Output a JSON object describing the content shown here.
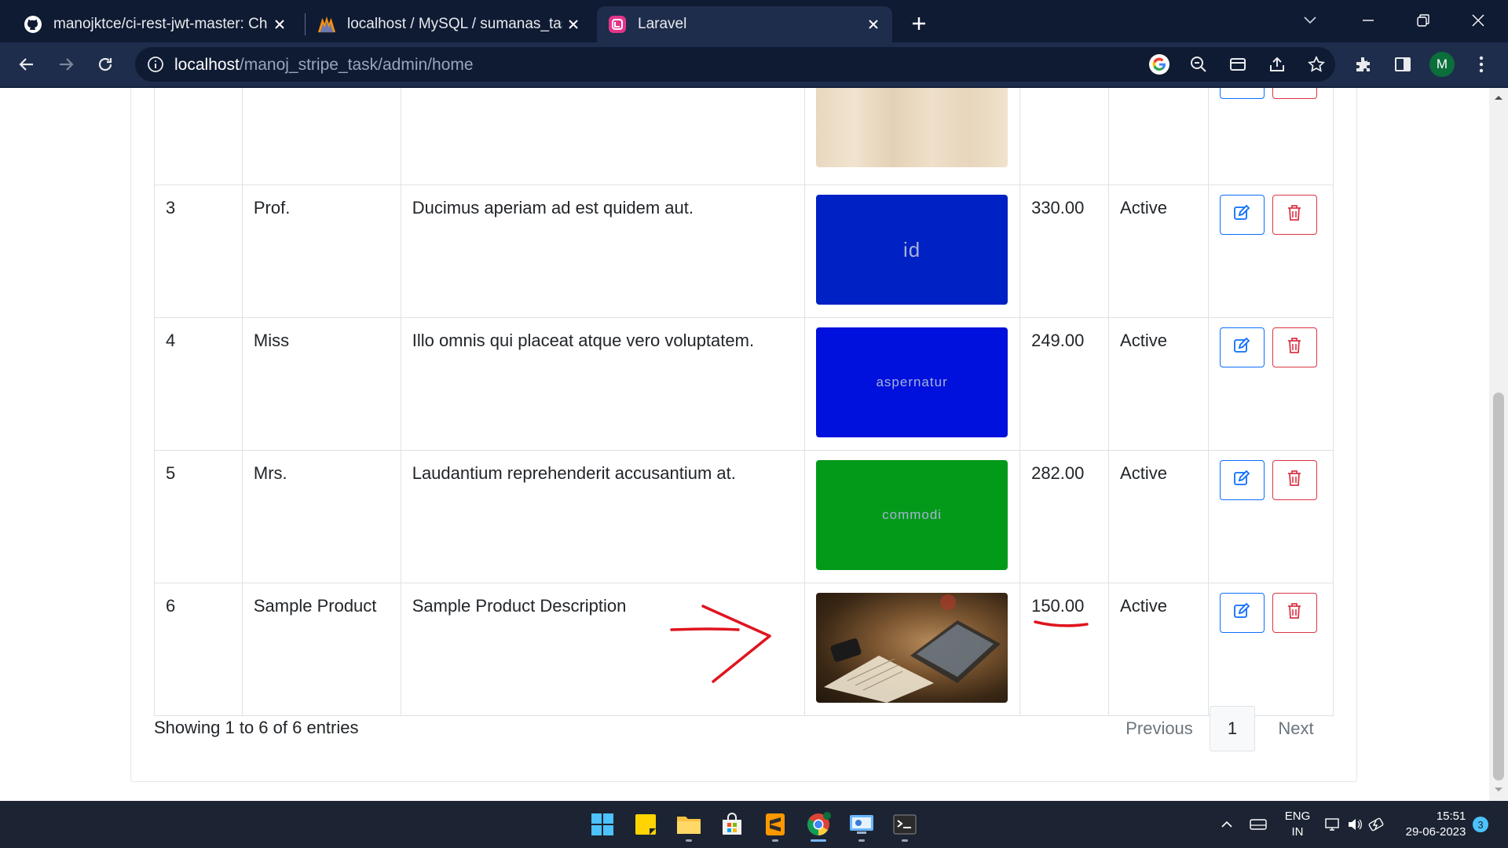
{
  "browser": {
    "tabs": [
      {
        "title": "manojktce/ci-rest-jwt-master: Ch",
        "icon": "github-icon",
        "active": false
      },
      {
        "title": "localhost / MySQL / sumanas_tas",
        "icon": "phpmyadmin-icon",
        "active": false
      },
      {
        "title": "Laravel",
        "icon": "laravel-icon",
        "active": true
      }
    ],
    "url_host": "localhost",
    "url_path": "/manoj_stripe_task/admin/home",
    "profile_initial": "M"
  },
  "table": {
    "rows": [
      {
        "id": "",
        "title": "",
        "description": "",
        "image_label": "",
        "image_style": "wood",
        "price": "",
        "status": ""
      },
      {
        "id": "3",
        "title": "Prof.",
        "description": "Ducimus aperiam ad est quidem aut.",
        "image_label": "id",
        "image_color": "#0021c4",
        "price": "330.00",
        "status": "Active"
      },
      {
        "id": "4",
        "title": "Miss",
        "description": "Illo omnis qui placeat atque vero voluptatem.",
        "image_label": "aspernatur",
        "image_color": "#0010dd",
        "price": "249.00",
        "status": "Active"
      },
      {
        "id": "5",
        "title": "Mrs.",
        "description": "Laudantium reprehenderit accusantium at.",
        "image_label": "commodi",
        "image_color": "#039a19",
        "price": "282.00",
        "status": "Active"
      },
      {
        "id": "6",
        "title": "Sample Product",
        "description": "Sample Product Description",
        "image_label": "",
        "image_style": "photo",
        "price": "150.00",
        "status": "Active"
      }
    ]
  },
  "footer": {
    "info": "Showing 1 to 6 of 6 entries",
    "previous": "Previous",
    "page": "1",
    "next": "Next"
  },
  "taskbar": {
    "lang_top": "ENG",
    "lang_bottom": "IN",
    "time": "15:51",
    "date": "29-06-2023",
    "notifications": "3"
  },
  "colors": {
    "edit": "#0d6efd",
    "delete": "#dc3545",
    "annotation": "#e0141e"
  }
}
